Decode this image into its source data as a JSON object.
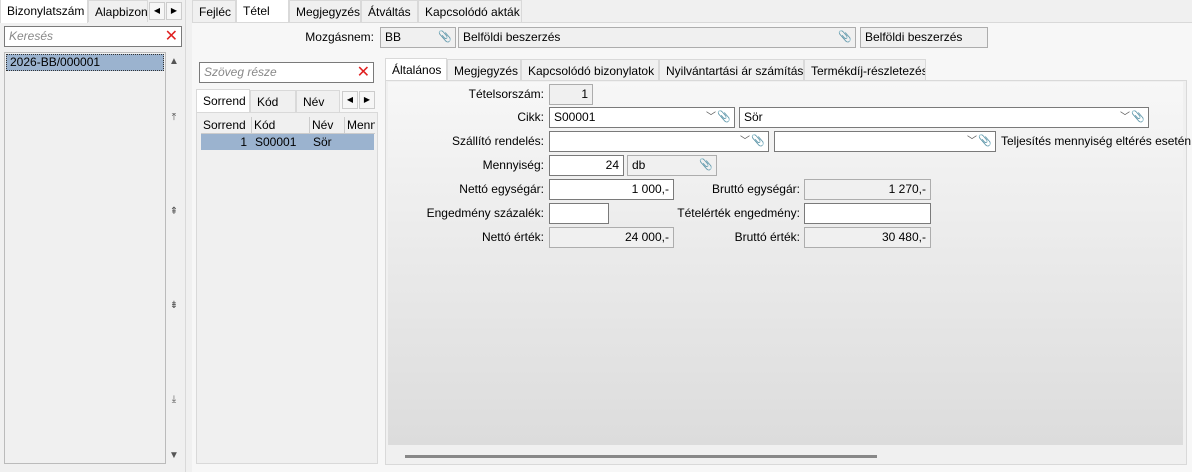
{
  "left": {
    "tabs": [
      "Bizonylatszám",
      "Alapbizon"
    ],
    "search_placeholder": "Keresés",
    "items": [
      "2026-BB/000001"
    ],
    "scroll_icons": [
      "▲",
      "⤒",
      "⇞",
      "⇟",
      "⤓",
      "▼"
    ]
  },
  "main": {
    "tabs": [
      "Fejléc",
      "Tétel",
      "Megjegyzés",
      "Átváltás",
      "Kapcsolódó akták"
    ],
    "selected_tab": "Tétel",
    "mozgasnem": {
      "label": "Mozgásnem:",
      "code": "BB",
      "name": "Belföldi beszerzés",
      "name2": "Belföldi beszerzés"
    }
  },
  "items_panel": {
    "search_placeholder": "Szöveg része",
    "tabs": [
      "Sorrend",
      "Kód",
      "Név"
    ],
    "columns": [
      "Sorrend",
      "Kód",
      "Név",
      "Menn"
    ],
    "rows": [
      {
        "sorrend": "1",
        "kod": "S00001",
        "nev": "Sör"
      }
    ]
  },
  "detail": {
    "tabs": [
      "Általános",
      "Megjegyzés",
      "Kapcsolódó bizonylatok",
      "Nyilvántartási ár számítás",
      "Termékdíj-részletezés"
    ],
    "fields": {
      "tetelsorszam": {
        "label": "Tételsorszám:",
        "value": "1"
      },
      "cikk": {
        "label": "Cikk:",
        "code": "S00001",
        "name": "Sör"
      },
      "szallito": {
        "label": "Szállító rendelés:",
        "value": "",
        "value2": "",
        "note": "Teljesítés mennyiség eltérés esetén"
      },
      "mennyiseg": {
        "label": "Mennyiség:",
        "value": "24",
        "unit": "db"
      },
      "netto_egysegar": {
        "label": "Nettó egységár:",
        "value": "1 000,-"
      },
      "brutto_egysegar": {
        "label": "Bruttó egységár:",
        "value": "1 270,-"
      },
      "engedmeny_szazalek": {
        "label": "Engedmény százalék:",
        "value": ""
      },
      "tetelertek_engedmeny": {
        "label": "Tételérték engedmény:",
        "value": ""
      },
      "netto_ertek": {
        "label": "Nettó érték:",
        "value": "24 000,-"
      },
      "brutto_ertek": {
        "label": "Bruttó érték:",
        "value": "30 480,-"
      }
    }
  }
}
